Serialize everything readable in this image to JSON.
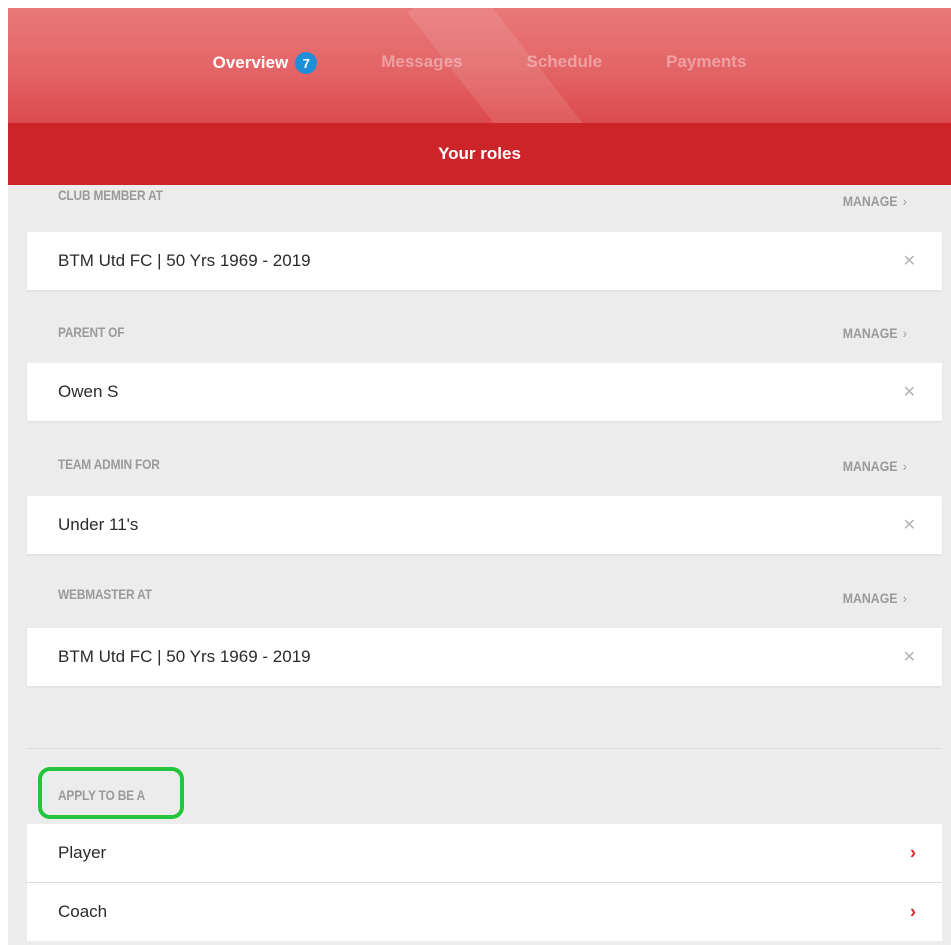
{
  "tabs": [
    {
      "label": "Overview",
      "badge": "7",
      "active": true
    },
    {
      "label": "Messages",
      "active": false
    },
    {
      "label": "Schedule",
      "active": false
    },
    {
      "label": "Payments",
      "active": false
    }
  ],
  "roles_bar": {
    "title": "Your roles"
  },
  "manage_label": "MANAGE",
  "sections": [
    {
      "label": "CLUB MEMBER AT",
      "item": "BTM Utd FC | 50 Yrs 1969 - 2019"
    },
    {
      "label": "PARENT OF",
      "item": "Owen S"
    },
    {
      "label": "TEAM ADMIN FOR",
      "item": "Under 11's"
    },
    {
      "label": "WEBMASTER AT",
      "item": "BTM Utd FC | 50 Yrs 1969 - 2019"
    }
  ],
  "apply": {
    "label": "APPLY TO BE A",
    "options": [
      "Player",
      "Coach"
    ]
  },
  "icons": {
    "remove": "close-icon",
    "manage": "chevron-right-icon",
    "option": "chevron-right-icon"
  },
  "colors": {
    "header": "#e36466",
    "roles_bar": "#cc2429",
    "badge": "#1e8fd6",
    "highlight": "#24c43c",
    "arrow": "#d42a2f"
  }
}
